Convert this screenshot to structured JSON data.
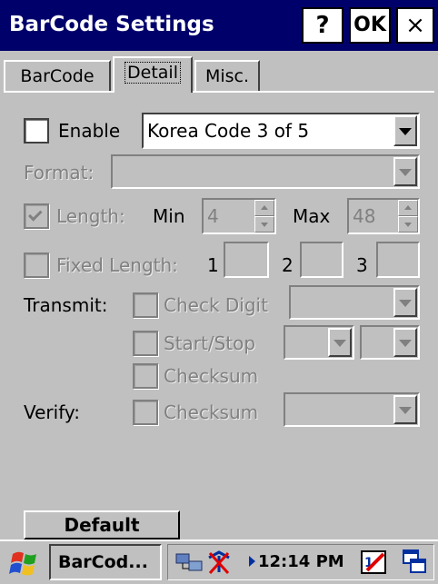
{
  "window": {
    "title": "BarCode Settings",
    "help_label": "?",
    "ok_label": "OK",
    "close_label": "×"
  },
  "tabs": [
    {
      "label": "BarCode",
      "selected": false
    },
    {
      "label": "Detail",
      "selected": true
    },
    {
      "label": "Misc.",
      "selected": false
    }
  ],
  "enable": {
    "label": "Enable",
    "checked": false,
    "selected_code": "Korea Code 3 of 5"
  },
  "format": {
    "label": "Format:",
    "value": ""
  },
  "length": {
    "label": "Length:",
    "checked": true,
    "min_label": "Min",
    "min_value": "4",
    "max_label": "Max",
    "max_value": "48"
  },
  "fixed_length": {
    "label": "Fixed Length:",
    "checked": false,
    "field1_label": "1",
    "field2_label": "2",
    "field3_label": "3"
  },
  "transmit": {
    "label": "Transmit:",
    "check_digit": "Check Digit",
    "start_stop": "Start/Stop",
    "checksum": "Checksum"
  },
  "verify": {
    "label": "Verify:",
    "checksum": "Checksum"
  },
  "default_button": "Default",
  "taskbar": {
    "app_button": "BarCod...",
    "clock": "12:14 PM"
  },
  "colors": {
    "title_bar": "#00006b",
    "face": "#c0c0c0",
    "disabled_text": "#808080"
  }
}
